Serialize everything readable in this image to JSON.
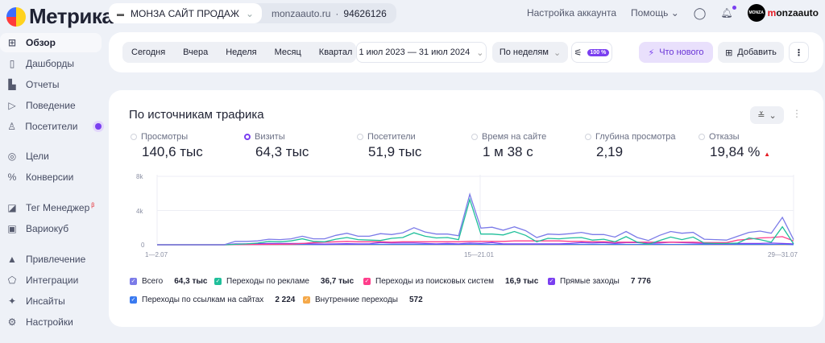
{
  "header": {
    "logo": "Метрика",
    "site_name": "МОНЗА САЙТ ПРОДАЖ",
    "site_domain": "monzaauto.ru",
    "site_id": "94626126",
    "account_settings": "Настройка аккаунта",
    "help": "Помощь",
    "avatar_text": "MONZA",
    "user_prefix": "m",
    "user_rest": "onzaauto"
  },
  "sidebar": {
    "items": [
      {
        "label": "Обзор",
        "icon": "grid-icon"
      },
      {
        "label": "Дашборды",
        "icon": "dashboards-icon"
      },
      {
        "label": "Отчеты",
        "icon": "bar-chart-icon"
      },
      {
        "label": "Поведение",
        "icon": "play-icon"
      },
      {
        "label": "Посетители",
        "icon": "user-icon"
      },
      {
        "label": "Цели",
        "icon": "target-icon"
      },
      {
        "label": "Конверсии",
        "icon": "percent-icon"
      },
      {
        "label": "Тег Менеджер",
        "icon": "tag-icon",
        "badge": "β"
      },
      {
        "label": "Вариокуб",
        "icon": "variocube-icon"
      },
      {
        "label": "Привлечение",
        "icon": "fire-icon"
      },
      {
        "label": "Интеграции",
        "icon": "puzzle-icon"
      },
      {
        "label": "Инсайты",
        "icon": "sparkle-icon"
      },
      {
        "label": "Настройки",
        "icon": "gear-icon"
      }
    ]
  },
  "toolbar": {
    "periods": [
      "Сегодня",
      "Вчера",
      "Неделя",
      "Месяц",
      "Квартал"
    ],
    "date_range": "1 июл 2023 — 31 июл 2024",
    "grouping": "По неделям",
    "sampling": "100 %",
    "whats_new": "Что нового",
    "add": "Добавить"
  },
  "widget": {
    "title": "По источникам трафика",
    "metrics": [
      {
        "label": "Просмотры",
        "value": "140,6 тыс"
      },
      {
        "label": "Визиты",
        "value": "64,3 тыс",
        "selected": true
      },
      {
        "label": "Посетители",
        "value": "51,9 тыс"
      },
      {
        "label": "Время на сайте",
        "value": "1 м 38 с"
      },
      {
        "label": "Глубина просмотра",
        "value": "2,19"
      },
      {
        "label": "Отказы",
        "value": "19,84 %",
        "trend": "up"
      }
    ]
  },
  "chart_data": {
    "type": "line",
    "ylim": [
      0,
      8000
    ],
    "yticks": [
      "0",
      "4k",
      "8k"
    ],
    "xtick_labels": [
      "1—2.07",
      "15—21.01",
      "29—31.07"
    ],
    "grid": true,
    "series": [
      {
        "name": "Всего",
        "total": "64,3 тыс",
        "color": "#7b7be8",
        "values": [
          0,
          0,
          0,
          0,
          0,
          0,
          0,
          400,
          400,
          450,
          650,
          600,
          700,
          1000,
          700,
          700,
          1100,
          1350,
          1000,
          1000,
          1300,
          1200,
          1400,
          2000,
          1500,
          1250,
          1250,
          1050,
          5900,
          1950,
          2050,
          1700,
          2100,
          1650,
          850,
          1250,
          1200,
          1300,
          1450,
          1200,
          1200,
          900,
          1550,
          850,
          500,
          1100,
          1550,
          1350,
          1450,
          650,
          600,
          550,
          1000,
          1450,
          1600,
          1350,
          3200,
          600
        ]
      },
      {
        "name": "Переходы по рекламе",
        "total": "36,7 тыс",
        "color": "#1fbf9a",
        "values": [
          0,
          0,
          0,
          0,
          0,
          0,
          0,
          50,
          100,
          200,
          400,
          350,
          450,
          700,
          400,
          350,
          650,
          850,
          600,
          550,
          500,
          750,
          850,
          1400,
          1000,
          800,
          850,
          600,
          5300,
          1250,
          1250,
          1150,
          1550,
          1100,
          350,
          750,
          700,
          800,
          850,
          550,
          650,
          350,
          950,
          300,
          50,
          500,
          900,
          600,
          900,
          200,
          150,
          150,
          200,
          800,
          600,
          300,
          2100,
          100
        ]
      },
      {
        "name": "Переходы из поисковых систем",
        "total": "16,9 тыс",
        "color": "#ff3d8b",
        "values": [
          0,
          0,
          0,
          0,
          0,
          0,
          0,
          20,
          30,
          40,
          50,
          60,
          80,
          150,
          250,
          300,
          350,
          400,
          350,
          350,
          350,
          300,
          350,
          350,
          350,
          350,
          350,
          350,
          400,
          400,
          400,
          400,
          450,
          450,
          450,
          450,
          450,
          400,
          400,
          350,
          350,
          300,
          300,
          300,
          300,
          300,
          300,
          300,
          300,
          250,
          250,
          250,
          550,
          650,
          800,
          850,
          950,
          450
        ]
      },
      {
        "name": "Прямые заходы",
        "total": "7 776",
        "color": "#7a3ff0",
        "values": [
          0,
          0,
          0,
          0,
          0,
          0,
          0,
          100,
          100,
          120,
          150,
          150,
          150,
          150,
          100,
          80,
          100,
          120,
          100,
          100,
          250,
          200,
          200,
          200,
          150,
          100,
          150,
          100,
          200,
          150,
          250,
          100,
          100,
          100,
          100,
          100,
          100,
          150,
          250,
          200,
          250,
          150,
          250,
          250,
          150,
          200,
          300,
          250,
          200,
          150,
          100,
          100,
          150,
          150,
          150,
          200,
          150,
          100
        ]
      },
      {
        "name": "Переходы по ссылкам на сайтах",
        "total": "2 224",
        "color": "#3a7af0",
        "values": [
          0,
          0,
          0,
          0,
          0,
          0,
          0,
          30,
          30,
          30,
          40,
          40,
          40,
          40,
          30,
          30,
          40,
          40,
          40,
          40,
          40,
          40,
          40,
          40,
          40,
          40,
          40,
          40,
          60,
          40,
          40,
          40,
          40,
          40,
          40,
          40,
          40,
          40,
          40,
          40,
          40,
          40,
          40,
          40,
          40,
          40,
          40,
          40,
          40,
          40,
          40,
          40,
          40,
          40,
          40,
          40,
          60,
          20
        ]
      },
      {
        "name": "Внутренние переходы",
        "total": "572",
        "color": "#f5a94a",
        "values": [
          0,
          0,
          0,
          0,
          0,
          0,
          0,
          10,
          10,
          10,
          10,
          10,
          10,
          10,
          10,
          10,
          10,
          10,
          10,
          10,
          10,
          10,
          10,
          10,
          10,
          10,
          10,
          10,
          20,
          10,
          10,
          10,
          10,
          10,
          10,
          10,
          10,
          10,
          10,
          10,
          10,
          10,
          10,
          10,
          10,
          10,
          10,
          10,
          10,
          10,
          10,
          10,
          10,
          10,
          10,
          10,
          20,
          5
        ]
      }
    ]
  }
}
